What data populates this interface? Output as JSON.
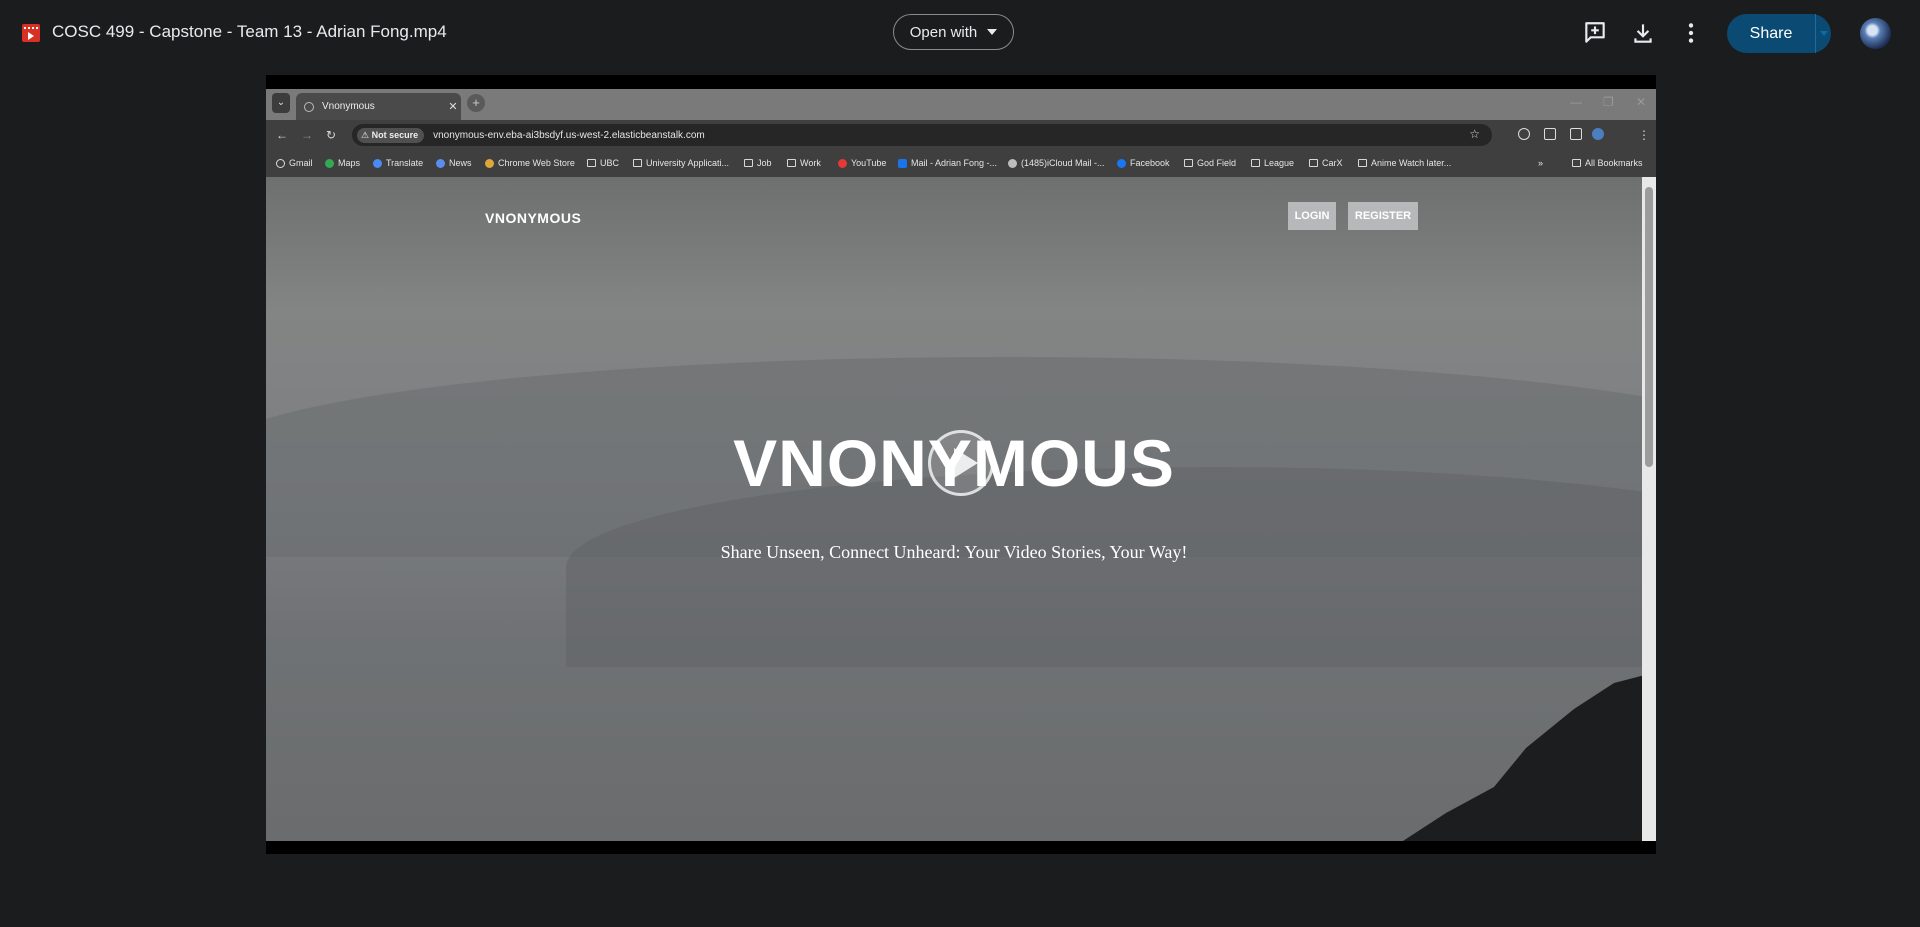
{
  "file": {
    "title": "COSC 499 - Capstone - Team 13 - Adrian Fong.mp4"
  },
  "toolbar": {
    "open_with": "Open with",
    "share": "Share"
  },
  "browser": {
    "tab_title": "Vnonymous",
    "security_label": "Not secure",
    "url": "vnonymous-env.eba-ai3bsdyf.us-west-2.elasticbeanstalk.com",
    "bookmarks": [
      "Gmail",
      "Maps",
      "Translate",
      "News",
      "Chrome Web Store",
      "UBC",
      "University Applicati...",
      "Job",
      "Work",
      "YouTube",
      "Mail - Adrian Fong -...",
      "(1485)iCloud Mail -...",
      "Facebook",
      "God Field",
      "League",
      "CarX",
      "Anime Watch later..."
    ],
    "all_bookmarks": "All Bookmarks"
  },
  "site": {
    "brand": "VNONYMOUS",
    "login": "LOGIN",
    "register": "REGISTER",
    "hero": "VNONYMOUS",
    "tagline": "Share Unseen, Connect Unheard: Your Video Stories, Your Way!"
  }
}
